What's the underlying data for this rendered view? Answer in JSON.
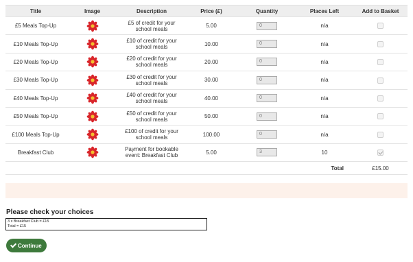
{
  "table": {
    "headers": [
      "Title",
      "Image",
      "Description",
      "Price (£)",
      "Quantity",
      "Places Left",
      "Add to Basket"
    ],
    "rows": [
      {
        "title": "£5 Meals Top-Up",
        "image": "flower-icon",
        "description": "£5 of credit for your school meals",
        "price": "5.00",
        "quantity": "0",
        "places_left": "n/a",
        "checked": false
      },
      {
        "title": "£10 Meals Top-Up",
        "image": "flower-icon",
        "description": "£10 of credit for your school meals",
        "price": "10.00",
        "quantity": "0",
        "places_left": "n/a",
        "checked": false
      },
      {
        "title": "£20 Meals Top-Up",
        "image": "flower-icon",
        "description": "£20 of credit for your school meals",
        "price": "20.00",
        "quantity": "0",
        "places_left": "n/a",
        "checked": false
      },
      {
        "title": "£30 Meals Top-Up",
        "image": "flower-icon",
        "description": "£30 of credit for your school meals",
        "price": "30.00",
        "quantity": "0",
        "places_left": "n/a",
        "checked": false
      },
      {
        "title": "£40 Meals Top-Up",
        "image": "flower-icon",
        "description": "£40 of credit for your school meals",
        "price": "40.00",
        "quantity": "0",
        "places_left": "n/a",
        "checked": false
      },
      {
        "title": "£50 Meals Top-Up",
        "image": "flower-icon",
        "description": "£50 of credit for your school meals",
        "price": "50.00",
        "quantity": "0",
        "places_left": "n/a",
        "checked": false
      },
      {
        "title": "£100 Meals Top-Up",
        "image": "flower-icon",
        "description": "£100 of credit for your school meals",
        "price": "100.00",
        "quantity": "0",
        "places_left": "n/a",
        "checked": false
      },
      {
        "title": "Breakfast Club",
        "image": "flower-icon",
        "description": "Payment for bookable event: Breakfast Club",
        "price": "5.00",
        "quantity": "3",
        "places_left": "10",
        "checked": true
      }
    ],
    "total_label": "Total",
    "total_value": "£15.00"
  },
  "choices": {
    "title": "Please check your choices",
    "line1": "3 x Breakfast Club = £15",
    "line2": "Total = £15"
  },
  "continue_label": "Continue",
  "colors": {
    "header_bg": "#eeeeee",
    "notice_bg": "#fdf1ea",
    "button_green": "#3e7a3c",
    "flower_red": "#d9262b",
    "flower_center": "#f2c12e"
  }
}
